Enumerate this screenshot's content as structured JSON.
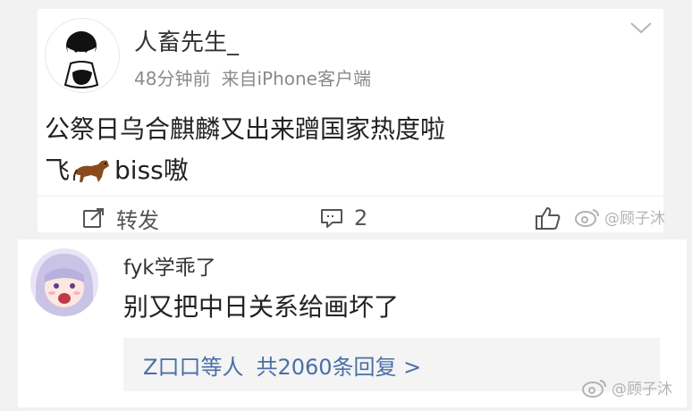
{
  "post": {
    "author": "人畜先生_",
    "time": "48分钟前",
    "source": "来自iPhone客户端",
    "text_line1": "公祭日乌合麒麟又出来蹭国家热度啦",
    "text_line2_pre": "飞",
    "text_line2_post": "biss嗷",
    "actions": {
      "repost_label": "转发",
      "comment_count": "2"
    },
    "icons": {
      "menu": "chevron-down-icon",
      "repost": "share-icon",
      "comment": "comment-icon",
      "like": "thumbs-up-icon",
      "emoji": "horse-emoji-icon"
    }
  },
  "comment": {
    "author": "fyk学乖了",
    "text": "别又把中日关系给画坏了",
    "replies_who": "Z口口等人",
    "replies_count": "共2060条回复 >"
  },
  "watermark": {
    "text": "@顾子沐",
    "icon": "weibo-logo-icon"
  },
  "colors": {
    "background": "#f2f2f2",
    "card": "#ffffff",
    "link_blue": "#4a6fa5",
    "meta_gray": "#8a8a8a"
  }
}
